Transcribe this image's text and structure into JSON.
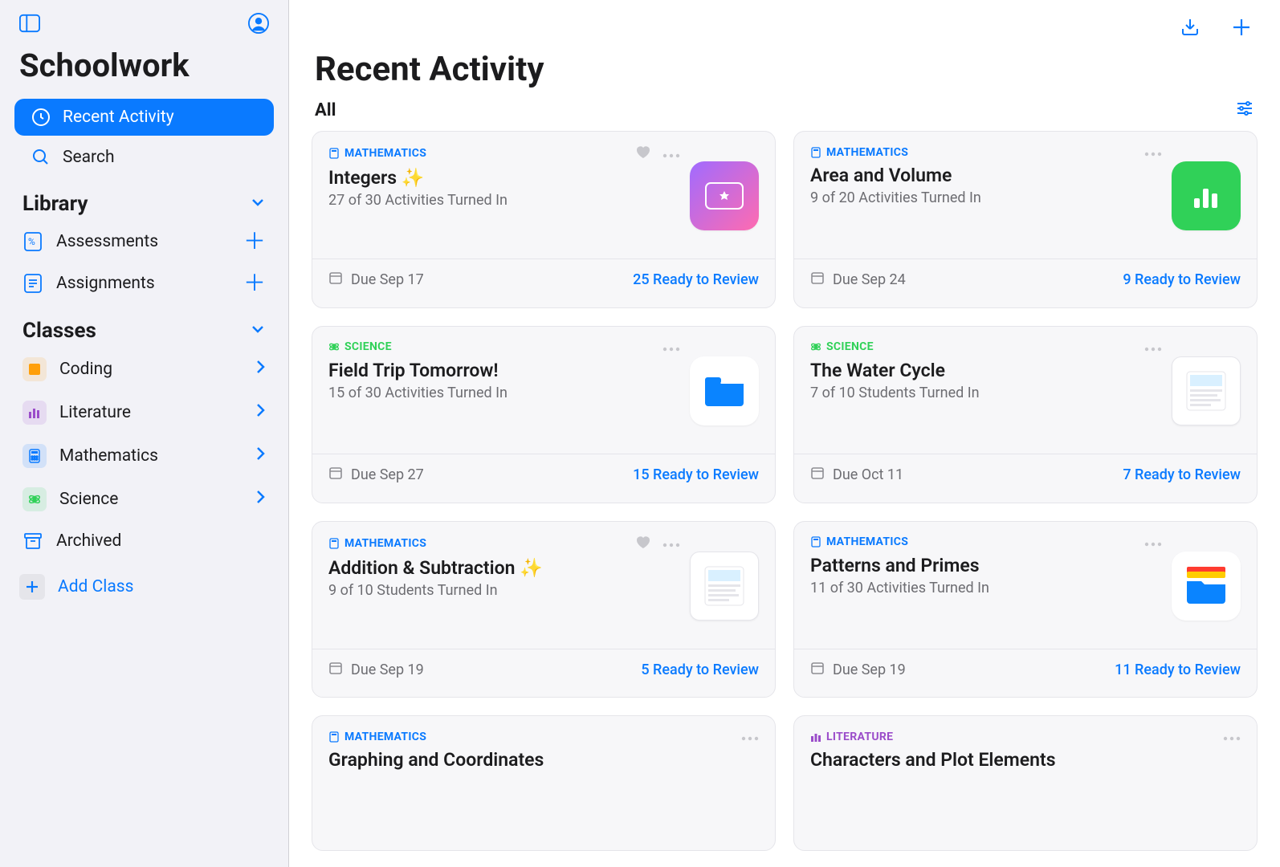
{
  "sidebar": {
    "panel_icon": "sidebar-panel",
    "profile_icon": "profile",
    "app_title": "Schoolwork",
    "nav": [
      {
        "id": "recent",
        "label": "Recent Activity",
        "icon": "clock",
        "active": true
      },
      {
        "id": "search",
        "label": "Search",
        "icon": "search",
        "active": false
      }
    ],
    "library": {
      "header": "Library",
      "items": [
        {
          "id": "assessments",
          "label": "Assessments",
          "icon": "percent-card",
          "add": true
        },
        {
          "id": "assignments",
          "label": "Assignments",
          "icon": "list-card",
          "add": true
        }
      ]
    },
    "classes": {
      "header": "Classes",
      "items": [
        {
          "id": "coding",
          "label": "Coding",
          "color": "#ff9f0a",
          "icon": "code"
        },
        {
          "id": "literature",
          "label": "Literature",
          "color": "#9b4dca",
          "icon": "bars"
        },
        {
          "id": "mathematics",
          "label": "Mathematics",
          "color": "#0a7aff",
          "icon": "calc"
        },
        {
          "id": "science",
          "label": "Science",
          "color": "#30d158",
          "icon": "atom"
        }
      ],
      "archived_label": "Archived",
      "add_label": "Add Class"
    }
  },
  "header": {
    "download_icon": "download",
    "add_icon": "plus"
  },
  "main": {
    "title": "Recent Activity",
    "filter_label": "All",
    "filter_icon": "sliders"
  },
  "cards": [
    {
      "subject": "MATHEMATICS",
      "subject_class": "subject-math",
      "title": "Integers ✨",
      "sub": "27 of 30 Activities Turned In",
      "due": "Due Sep 17",
      "review": "25 Ready to Review",
      "fav": true,
      "thumb": "gradient-ticket"
    },
    {
      "subject": "MATHEMATICS",
      "subject_class": "subject-math",
      "title": "Area and Volume",
      "sub": "9 of 20 Activities Turned In",
      "due": "Due Sep 24",
      "review": "9 Ready to Review",
      "fav": false,
      "thumb": "green-chart"
    },
    {
      "subject": "SCIENCE",
      "subject_class": "subject-science",
      "title": "Field Trip Tomorrow!",
      "sub": "15 of 30 Activities Turned In",
      "due": "Due Sep 27",
      "review": "15 Ready to Review",
      "fav": false,
      "thumb": "folder-blue"
    },
    {
      "subject": "SCIENCE",
      "subject_class": "subject-science",
      "title": "The Water Cycle",
      "sub": "7 of 10 Students Turned In",
      "due": "Due Oct 11",
      "review": "7 Ready to Review",
      "fav": false,
      "thumb": "poster"
    },
    {
      "subject": "MATHEMATICS",
      "subject_class": "subject-math",
      "title": "Addition & Subtraction ✨",
      "sub": "9 of 10 Students Turned In",
      "due": "Due Sep 19",
      "review": "5 Ready to Review",
      "fav": true,
      "thumb": "worksheet"
    },
    {
      "subject": "MATHEMATICS",
      "subject_class": "subject-math",
      "title": "Patterns and Primes",
      "sub": "11 of 30 Activities Turned In",
      "due": "Due Sep 19",
      "review": "11 Ready to Review",
      "fav": false,
      "thumb": "folder-color"
    },
    {
      "subject": "MATHEMATICS",
      "subject_class": "subject-math",
      "title": "Graphing and Coordinates",
      "sub": "",
      "due": "",
      "review": "",
      "fav": false,
      "thumb": "none"
    },
    {
      "subject": "LITERATURE",
      "subject_class": "subject-literature",
      "title": "Characters and Plot Elements",
      "sub": "",
      "due": "",
      "review": "",
      "fav": false,
      "thumb": "none"
    }
  ]
}
